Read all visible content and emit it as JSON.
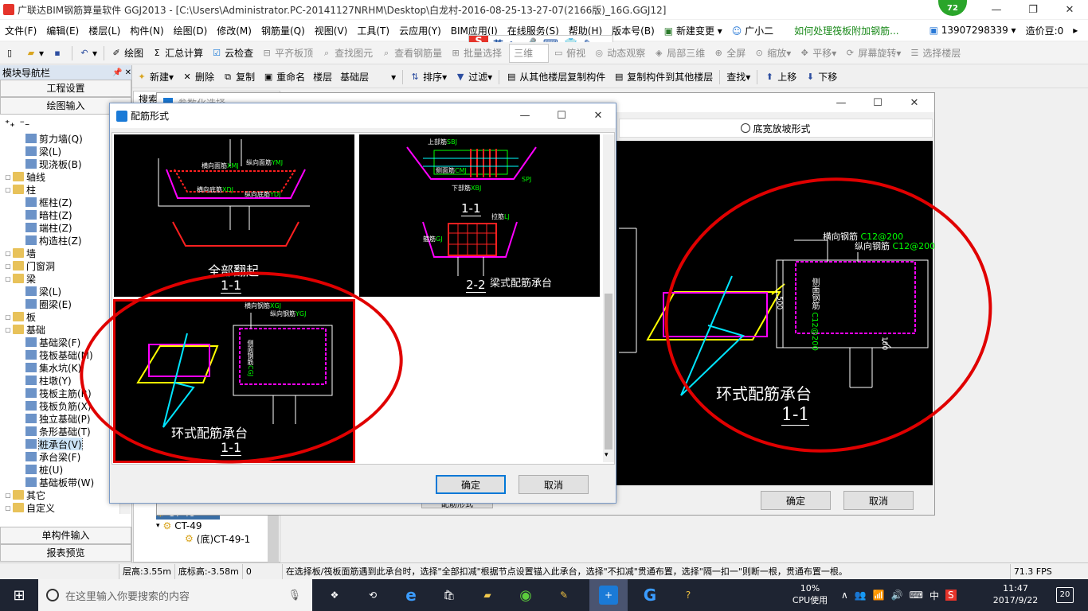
{
  "window": {
    "title": "广联达BIM钢筋算量软件 GGJ2013 - [C:\\Users\\Administrator.PC-20141127NRHM\\Desktop\\白龙村-2016-08-25-13-27-07(2166版)_16G.GGJ12]",
    "badge": "72"
  },
  "menu": {
    "items": [
      "文件(F)",
      "编辑(E)",
      "楼层(L)",
      "构件(N)",
      "绘图(D)",
      "修改(M)",
      "钢筋量(Q)",
      "视图(V)",
      "工具(T)",
      "云应用(Y)",
      "BIM应用(I)",
      "在线服务(S)",
      "帮助(H)",
      "版本号(B)"
    ],
    "new_change": "新建变更",
    "assistant": "广小二",
    "promo": "如何处理筏板附加钢筋...",
    "phone": "13907298339",
    "price_label": "造价豆:0"
  },
  "ime": {
    "lang": "英"
  },
  "toolbar1": {
    "draw": "绘图",
    "sum": "汇总计算",
    "cloud_check": "云检查",
    "flat_top": "平齐板顶",
    "find_elem": "查找图元",
    "view_rebar": "查看钢筋量",
    "batch_select": "批量选择",
    "view_3d": "三维",
    "top_view": "俯视",
    "dynamic": "动态观察",
    "local_3d": "局部三维",
    "fullscreen": "全屏",
    "zoom": "缩放",
    "pan": "平移",
    "rotate": "屏幕旋转",
    "select_floor": "选择楼层"
  },
  "toolbar2": {
    "new": "新建",
    "delete": "删除",
    "copy": "复制",
    "rename": "重命名",
    "floor_label": "楼层",
    "floor_value": "基础层",
    "sort": "排序",
    "filter": "过滤",
    "copy_from": "从其他楼层复制构件",
    "copy_to": "复制构件到其他楼层",
    "find": "查找",
    "move_up": "上移",
    "move_down": "下移"
  },
  "left_panel": {
    "header": "模块导航栏",
    "pin": "ᵖ",
    "btn_project": "工程设置",
    "btn_draw": "绘图输入",
    "btn_single": "单构件输入",
    "btn_report": "报表预览",
    "tree": [
      {
        "label": "剪力墙(Q)",
        "level": 2,
        "kind": "leaf"
      },
      {
        "label": "梁(L)",
        "level": 2,
        "kind": "leaf"
      },
      {
        "label": "现浇板(B)",
        "level": 2,
        "kind": "leaf"
      },
      {
        "label": "轴线",
        "level": 0,
        "kind": "folder",
        "exp": "+"
      },
      {
        "label": "柱",
        "level": 0,
        "kind": "folder",
        "exp": "-"
      },
      {
        "label": "框柱(Z)",
        "level": 2,
        "kind": "leaf"
      },
      {
        "label": "暗柱(Z)",
        "level": 2,
        "kind": "leaf"
      },
      {
        "label": "端柱(Z)",
        "level": 2,
        "kind": "leaf"
      },
      {
        "label": "构造柱(Z)",
        "level": 2,
        "kind": "leaf"
      },
      {
        "label": "墙",
        "level": 0,
        "kind": "folder",
        "exp": "+"
      },
      {
        "label": "门窗洞",
        "level": 0,
        "kind": "folder",
        "exp": "+"
      },
      {
        "label": "梁",
        "level": 0,
        "kind": "folder",
        "exp": "-"
      },
      {
        "label": "梁(L)",
        "level": 2,
        "kind": "leaf"
      },
      {
        "label": "圈梁(E)",
        "level": 2,
        "kind": "leaf"
      },
      {
        "label": "板",
        "level": 0,
        "kind": "folder",
        "exp": "+"
      },
      {
        "label": "基础",
        "level": 0,
        "kind": "folder",
        "exp": "-"
      },
      {
        "label": "基础梁(F)",
        "level": 2,
        "kind": "leaf"
      },
      {
        "label": "筏板基础(M)",
        "level": 2,
        "kind": "leaf"
      },
      {
        "label": "集水坑(K)",
        "level": 2,
        "kind": "leaf"
      },
      {
        "label": "柱墩(Y)",
        "level": 2,
        "kind": "leaf"
      },
      {
        "label": "筏板主筋(R)",
        "level": 2,
        "kind": "leaf"
      },
      {
        "label": "筏板负筋(X)",
        "level": 2,
        "kind": "leaf"
      },
      {
        "label": "独立基础(P)",
        "level": 2,
        "kind": "leaf"
      },
      {
        "label": "条形基础(T)",
        "level": 2,
        "kind": "leaf"
      },
      {
        "label": "桩承台(V)",
        "level": 2,
        "kind": "leaf",
        "selected": true
      },
      {
        "label": "承台梁(F)",
        "level": 2,
        "kind": "leaf"
      },
      {
        "label": "桩(U)",
        "level": 2,
        "kind": "leaf"
      },
      {
        "label": "基础板带(W)",
        "level": 2,
        "kind": "leaf"
      },
      {
        "label": "其它",
        "level": 0,
        "kind": "folder",
        "exp": "+"
      },
      {
        "label": "自定义",
        "level": 0,
        "kind": "folder",
        "exp": "-"
      }
    ]
  },
  "mid_panel": {
    "tab": "搜索",
    "items": [
      {
        "label": "CT-48",
        "level": 0
      },
      {
        "label": "CT-49",
        "level": 0
      },
      {
        "label": "(底)CT-49-1",
        "level": 1
      }
    ]
  },
  "big_dialog": {
    "title": "参数化选择",
    "radio_label": "底宽放坡形式",
    "section_label": "1",
    "drawing": {
      "label_transverse": "横向钢筋",
      "label_transverse_val": "C12@200",
      "label_longitudinal": "纵向钢筋",
      "label_longitudinal_val": "C12@200",
      "label_side": "侧面钢筋",
      "label_side_val": "C12@200",
      "dim_500": "500",
      "dim_100": "100",
      "caption": "环式配筋承台",
      "section": "1-1"
    },
    "ok": "确定",
    "cancel": "取消",
    "hidden_button": "配筋形式"
  },
  "dialog": {
    "title": "配筋形式",
    "cell1": {
      "caption": "全部翻起",
      "section": "1-1",
      "l1": "横向面筋",
      "l1v": "XMJ",
      "l2": "纵向面筋",
      "l2v": "YMJ",
      "l3": "横向底筋",
      "l3v": "XDJ",
      "l4": "纵向底筋",
      "l4v": "YDJ"
    },
    "cell2": {
      "caption": "梁式配筋承台",
      "section_a": "1-1",
      "section_b": "2-2",
      "l1": "上部筋",
      "l1v": "SBJ",
      "l2": "下部筋",
      "l2v": "XBJ",
      "l3": "侧面筋",
      "l3v": "CMJ",
      "l4": "箍筋",
      "l4v": "GJ",
      "l5": "拉筋",
      "l5v": "LJ",
      "l6": "SPJ"
    },
    "cell3": {
      "caption": "环式配筋承台",
      "section": "1-1",
      "l1": "横向钢筋",
      "l1v": "XGJ",
      "l2": "纵向钢筋",
      "l2v": "YGJ",
      "l3": "侧面钢筋",
      "l3v": "CGJ"
    },
    "ok": "确定",
    "cancel": "取消"
  },
  "status": {
    "floor_height": "层高:3.55m",
    "bottom_elev": "底标高:-3.58m",
    "zero": "0",
    "hint": "在选择板/筏板面筋遇到此承台时，选择\"全部扣减\"根据节点设置锚入此承台，选择\"不扣减\"贯通布置，选择\"隔一扣一\"则断一根，贯通布置一根。",
    "fps": "71.3 FPS"
  },
  "taskbar": {
    "search_placeholder": "在这里输入你要搜索的内容",
    "cpu_pct": "10%",
    "cpu_label": "CPU使用",
    "ime": "中",
    "time": "11:47",
    "date": "2017/9/22",
    "notif": "20"
  },
  "colors": {
    "accent": "#0078d7",
    "annotation_red": "#e00000",
    "cad_bg": "#000000",
    "cad_magenta": "#ff00ff",
    "cad_yellow": "#ffff00",
    "cad_cyan": "#00e5ff",
    "cad_green": "#00ff00",
    "cad_red": "#ff2020"
  }
}
